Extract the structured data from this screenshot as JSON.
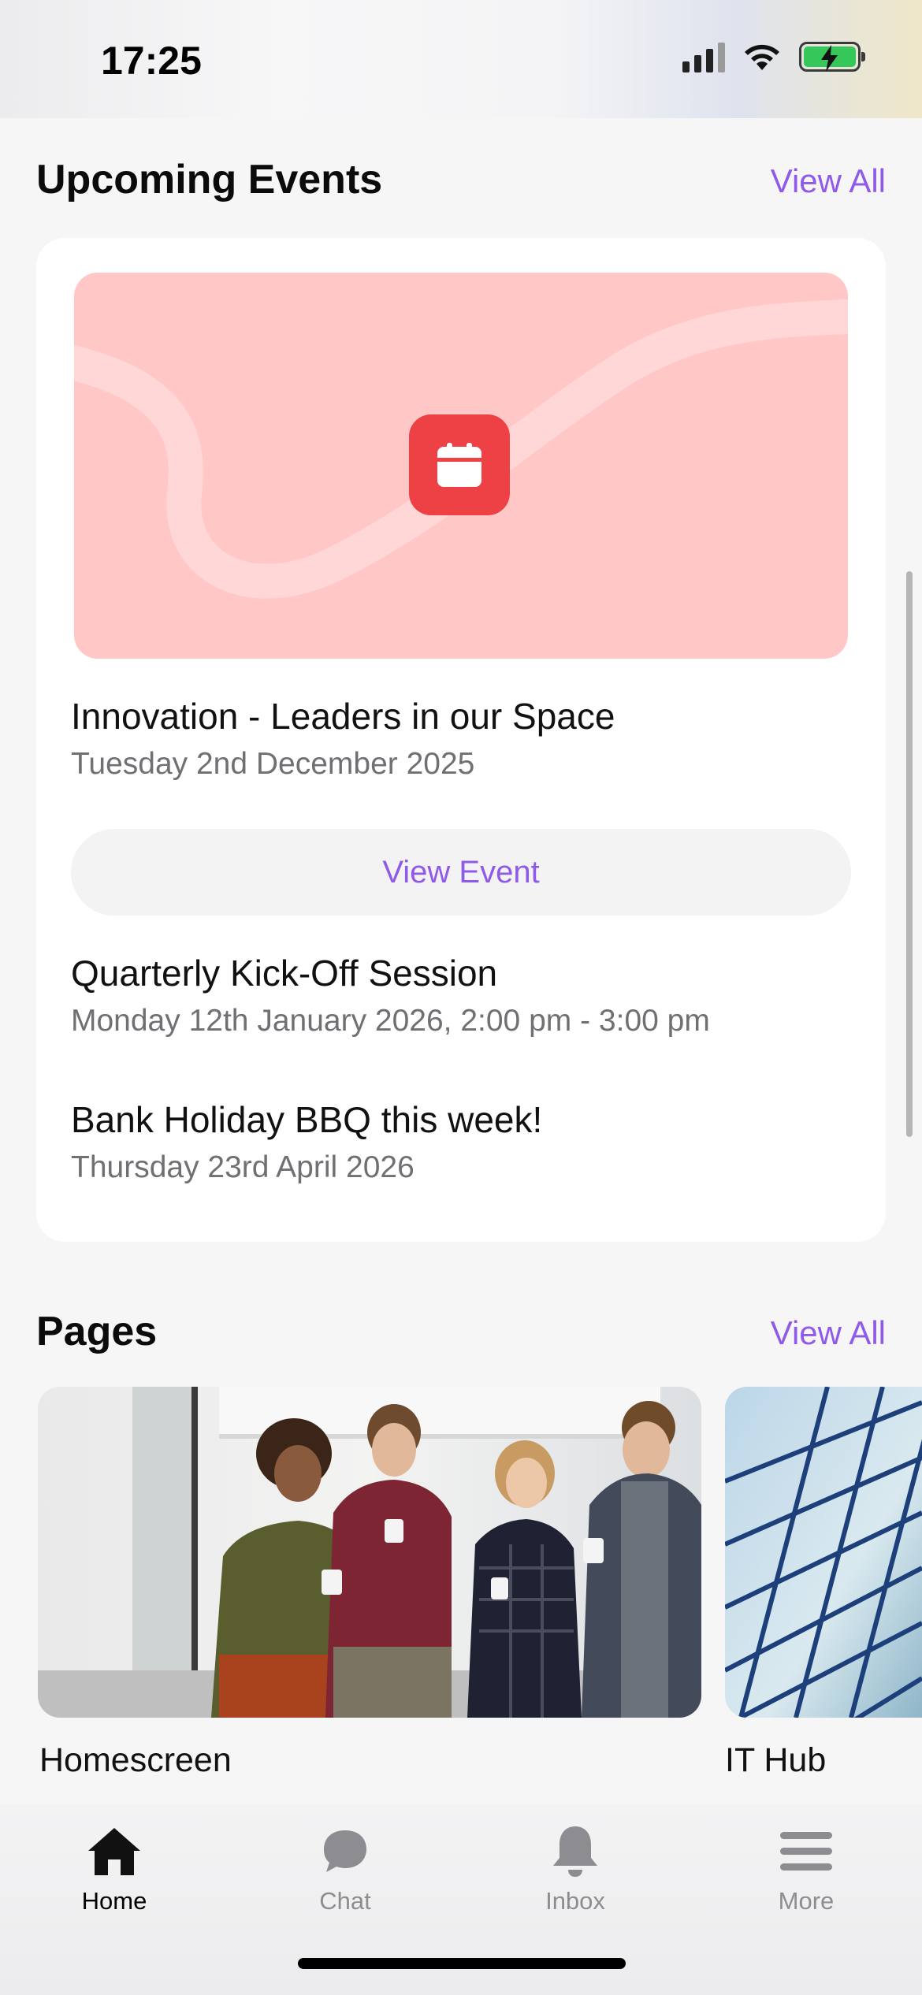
{
  "status_bar": {
    "time": "17:25"
  },
  "events_section": {
    "title": "Upcoming Events",
    "view_all_label": "View All",
    "featured": {
      "title": "Innovation - Leaders in our Space",
      "date": "Tuesday 2nd December 2025",
      "button_label": "View Event",
      "banner_color": "#ffc8c7",
      "icon": "calendar-icon",
      "icon_color": "#ee4145"
    },
    "items": [
      {
        "title": "Quarterly Kick-Off Session",
        "date": "Monday 12th January 2026, 2:00 pm - 3:00 pm"
      },
      {
        "title": "Bank Holiday BBQ this week!",
        "date": "Thursday 23rd April 2026"
      }
    ]
  },
  "pages_section": {
    "title": "Pages",
    "view_all_label": "View All",
    "items": [
      {
        "label": "Homescreen",
        "image": "office-team-photo"
      },
      {
        "label": "IT Hub",
        "image": "glass-building-photo"
      }
    ]
  },
  "tab_bar": {
    "tabs": [
      {
        "label": "Home",
        "icon": "home-icon",
        "active": true
      },
      {
        "label": "Chat",
        "icon": "chat-icon",
        "active": false
      },
      {
        "label": "Inbox",
        "icon": "bell-icon",
        "active": false
      },
      {
        "label": "More",
        "icon": "menu-icon",
        "active": false
      }
    ]
  },
  "colors": {
    "accent": "#8f5ae8",
    "background": "#f6f6f7"
  }
}
